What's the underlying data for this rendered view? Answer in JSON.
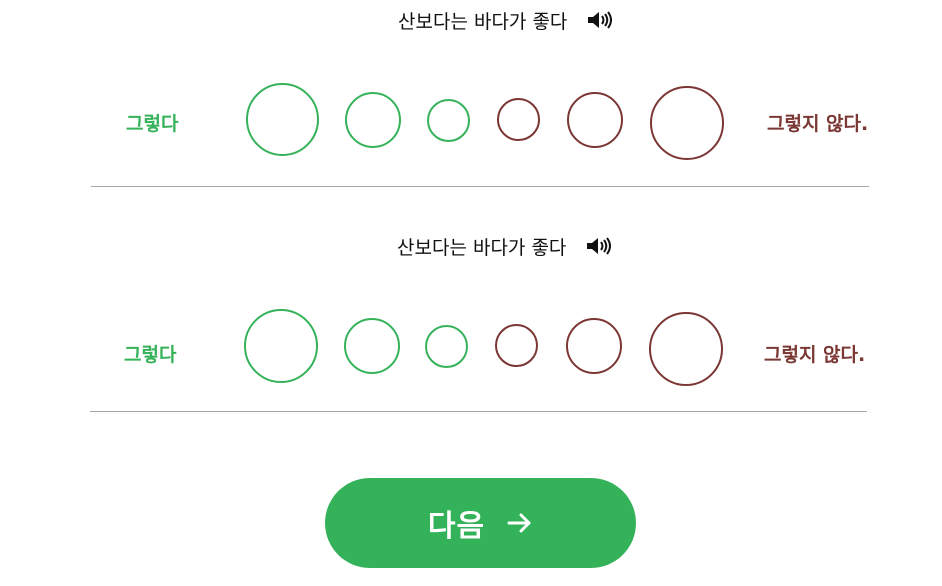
{
  "questions": [
    {
      "text": "산보다는 바다가 좋다",
      "agree_label": "그렇다",
      "disagree_label": "그렇지 않다."
    },
    {
      "text": "산보다는 바다가 좋다",
      "agree_label": "그렇다",
      "disagree_label": "그렇지 않다."
    }
  ],
  "next_button": {
    "label": "다음",
    "icon": "arrow-right-icon"
  },
  "colors": {
    "agree": "#36b25a",
    "disagree": "#7b3734",
    "button": "#34b259",
    "divider": "#a6a6a6"
  },
  "icons": {
    "audio": "speaker-icon"
  }
}
